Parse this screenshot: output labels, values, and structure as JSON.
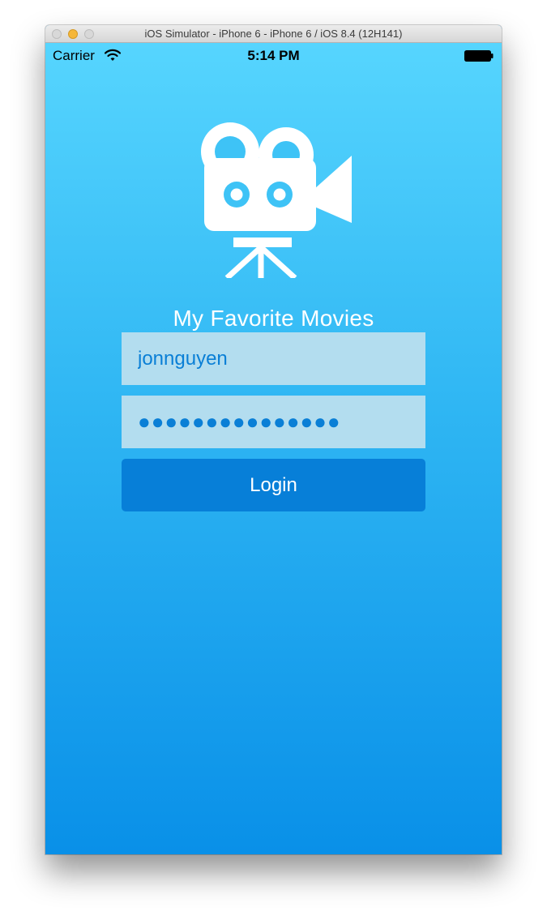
{
  "window": {
    "title": "iOS Simulator - iPhone 6 - iPhone 6 / iOS 8.4 (12H141)"
  },
  "status_bar": {
    "carrier": "Carrier",
    "time": "5:14 PM",
    "wifi_icon": "wifi-icon",
    "battery_icon": "battery-icon"
  },
  "app": {
    "logo_icon": "movie-camera-icon",
    "title": "My Favorite Movies"
  },
  "form": {
    "username_value": "jonnguyen",
    "password_value": "●●●●●●●●●●●●●●●",
    "login_label": "Login"
  },
  "colors": {
    "gradient_top": "#56d5fe",
    "gradient_bottom": "#0990e8",
    "field_background": "#b3ddef",
    "field_text": "#0a7fd6",
    "button_background": "#077fd8",
    "button_text": "#ffffff"
  }
}
